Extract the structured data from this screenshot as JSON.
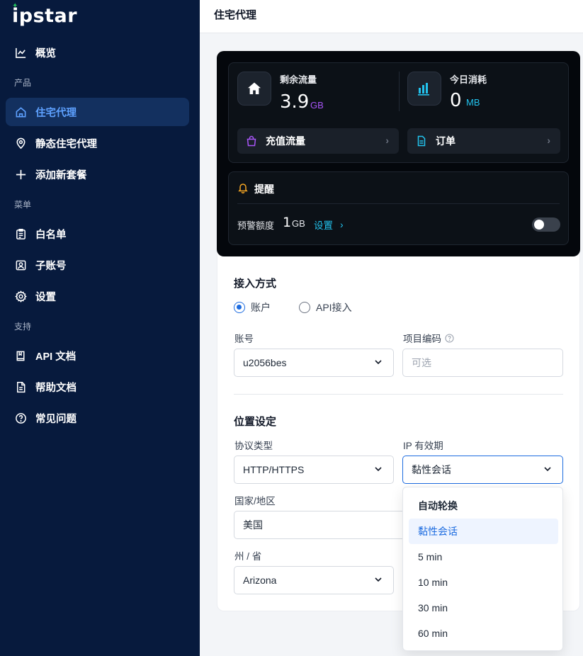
{
  "app": {
    "logo": "ipstar"
  },
  "sidebar": {
    "overview": "概览",
    "section_product": "产品",
    "residential_proxy": "住宅代理",
    "static_residential_proxy": "静态住宅代理",
    "add_package": "添加新套餐",
    "section_menu": "菜单",
    "whitelist": "白名单",
    "sub_account": "子账号",
    "settings": "设置",
    "section_support": "支持",
    "api_docs": "API 文档",
    "help_docs": "帮助文档",
    "faq": "常见问题"
  },
  "header": {
    "title": "住宅代理"
  },
  "stats": {
    "remaining_label": "剩余流量",
    "remaining_value": "3.9",
    "remaining_unit": "GB",
    "today_label": "今日消耗",
    "today_value": "0",
    "today_unit": "MB",
    "recharge_label": "充值流量",
    "orders_label": "订单"
  },
  "reminder": {
    "title": "提醒",
    "alert_label": "预警额度",
    "alert_value": "1",
    "alert_unit": "GB",
    "set_label": "设置",
    "toggle_on": false
  },
  "access": {
    "title": "接入方式",
    "radio_account": "账户",
    "radio_api": "API接入",
    "account_label": "账号",
    "account_value": "u2056bes",
    "project_label": "项目编码",
    "project_placeholder": "可选"
  },
  "location": {
    "title": "位置设定",
    "protocol_label": "协议类型",
    "protocol_value": "HTTP/HTTPS",
    "ip_validity_label": "IP 有效期",
    "ip_validity_value": "黏性会话",
    "country_label": "国家/地区",
    "country_value": "美国",
    "state_label": "州 / 省",
    "state_value": "Arizona"
  },
  "dropdown": {
    "items": [
      "自动轮换",
      "黏性会话",
      "5 min",
      "10 min",
      "30 min",
      "60 min"
    ]
  },
  "colors": {
    "sidebar_bg": "#071a3d",
    "accent": "#1d6ce0",
    "purple_unit": "#a855f7",
    "cyan_unit": "#22c3ee"
  }
}
